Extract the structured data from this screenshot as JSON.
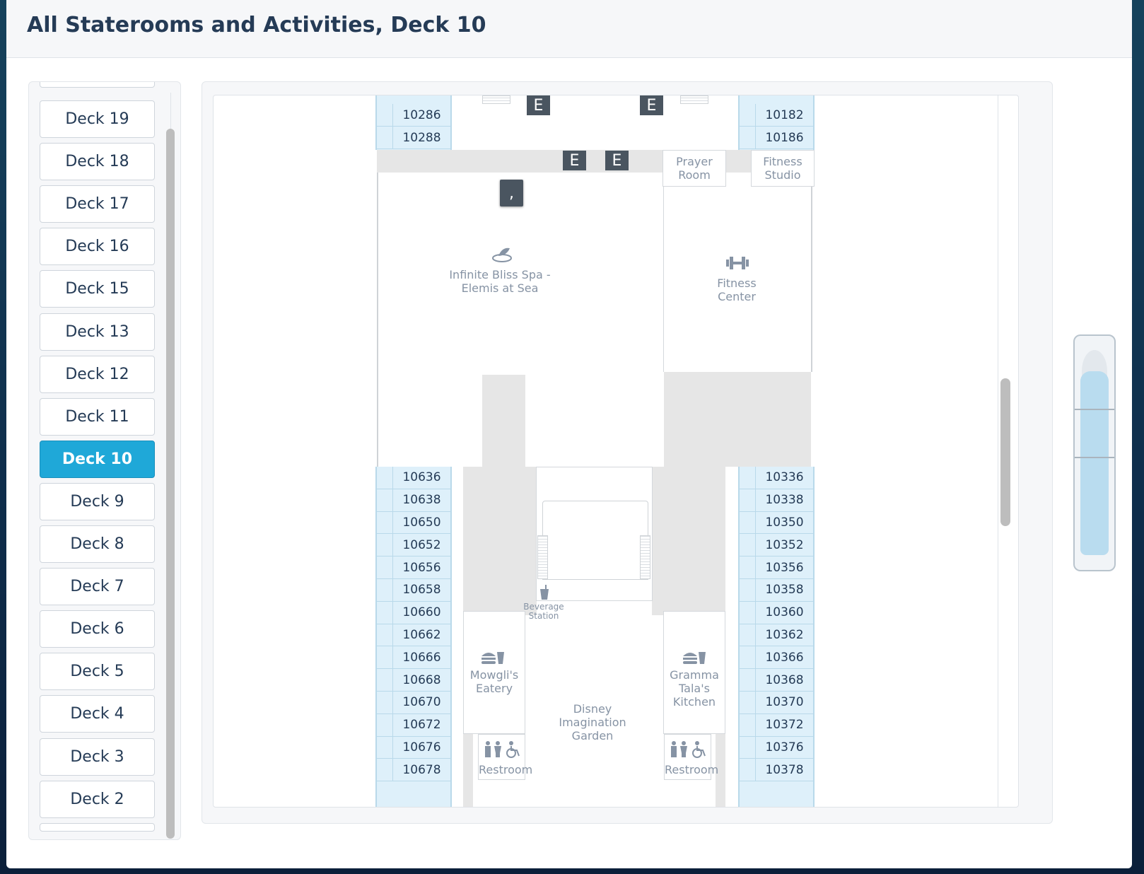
{
  "header": {
    "title": "All Staterooms and Activities, Deck 10"
  },
  "decks": [
    {
      "label": "Deck 19",
      "active": false
    },
    {
      "label": "Deck 18",
      "active": false
    },
    {
      "label": "Deck 17",
      "active": false
    },
    {
      "label": "Deck 16",
      "active": false
    },
    {
      "label": "Deck 15",
      "active": false
    },
    {
      "label": "Deck 13",
      "active": false
    },
    {
      "label": "Deck 12",
      "active": false
    },
    {
      "label": "Deck 11",
      "active": false
    },
    {
      "label": "Deck 10",
      "active": true
    },
    {
      "label": "Deck 9",
      "active": false
    },
    {
      "label": "Deck 8",
      "active": false
    },
    {
      "label": "Deck 7",
      "active": false
    },
    {
      "label": "Deck 6",
      "active": false
    },
    {
      "label": "Deck 5",
      "active": false
    },
    {
      "label": "Deck 4",
      "active": false
    },
    {
      "label": "Deck 3",
      "active": false
    },
    {
      "label": "Deck 2",
      "active": false
    }
  ],
  "map": {
    "elevator_label": "E",
    "marker_label": ",",
    "left_top_cabins": [
      "10286",
      "10288"
    ],
    "right_top_cabins": [
      "10182",
      "10186"
    ],
    "left_cabins": [
      "10636",
      "10638",
      "10650",
      "10652",
      "10656",
      "10658",
      "10660",
      "10662",
      "10666",
      "10668",
      "10670",
      "10672",
      "10676",
      "10678"
    ],
    "right_cabins": [
      "10336",
      "10338",
      "10350",
      "10352",
      "10356",
      "10358",
      "10360",
      "10362",
      "10366",
      "10368",
      "10370",
      "10372",
      "10376",
      "10378"
    ],
    "prayer_room": "Prayer Room",
    "fitness_studio": "Fitness Studio",
    "spa": "Infinite Bliss Spa - Elemis at Sea",
    "fitness_center": "Fitness Center",
    "beverage_station": "Beverage Station",
    "mowglis_eatery": "Mowgli's Eatery",
    "gramma_tala": "Gramma Tala's Kitchen",
    "imagination_garden": "Disney Imagination Garden",
    "restroom": "Restroom"
  },
  "icons": {
    "spa": "spa-icon",
    "fitness": "dumbbell-icon",
    "dining": "burger-drink-icon",
    "beverage": "drink-icon",
    "restroom": "restroom-accessible-icon"
  },
  "colors": {
    "active_deck": "#1fa8d8",
    "cabin_fill": "#def0fa",
    "elevator": "#4a5560",
    "title": "#253b56"
  }
}
